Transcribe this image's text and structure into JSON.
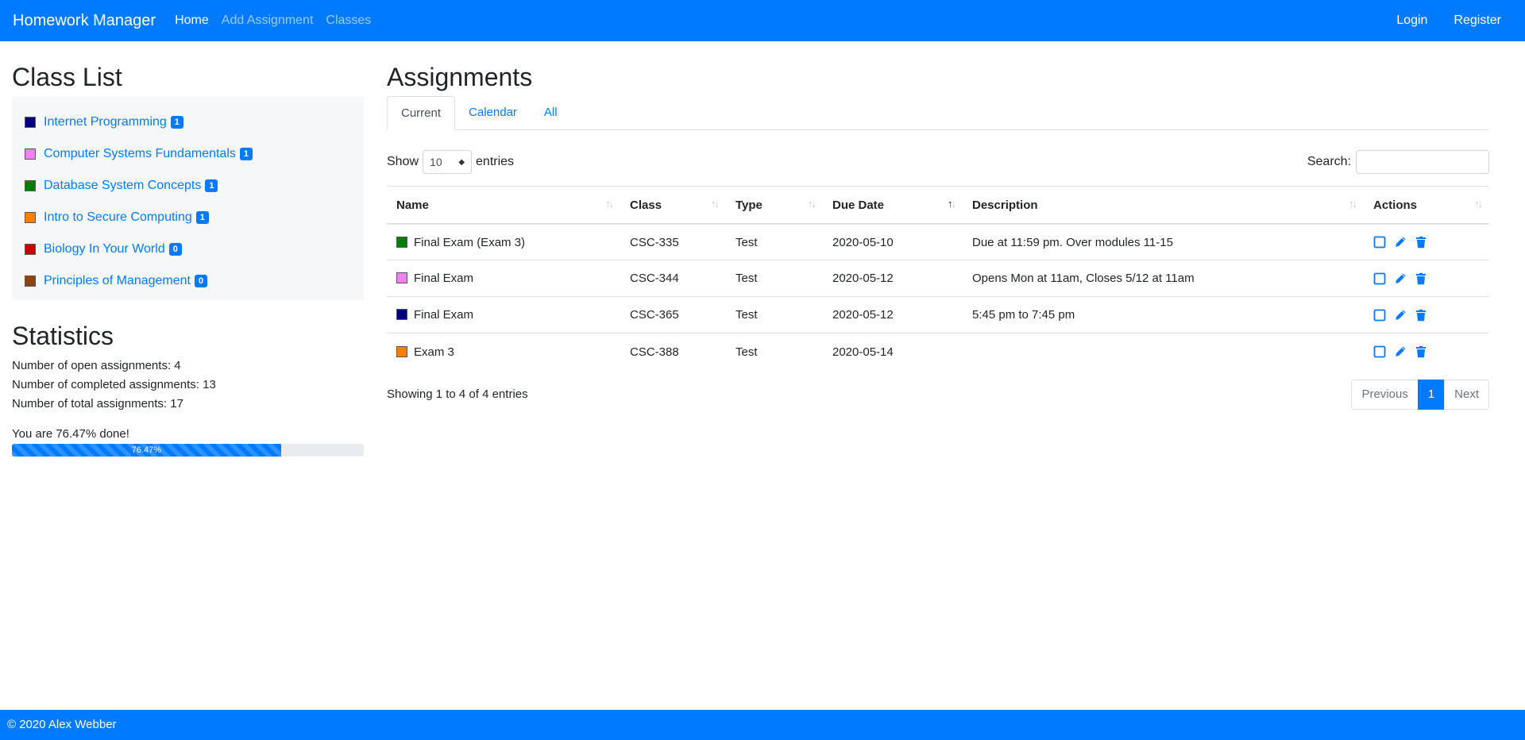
{
  "nav": {
    "brand": "Homework Manager",
    "links": [
      "Home",
      "Add Assignment",
      "Classes"
    ],
    "right_links": [
      "Login",
      "Register"
    ]
  },
  "class_list": {
    "title": "Class List",
    "items": [
      {
        "name": "Internet Programming",
        "count": "1",
        "color": "#000080"
      },
      {
        "name": "Computer Systems Fundamentals",
        "count": "1",
        "color": "#ee82ee"
      },
      {
        "name": "Database System Concepts",
        "count": "1",
        "color": "#008000"
      },
      {
        "name": "Intro to Secure Computing",
        "count": "1",
        "color": "#ff8000"
      },
      {
        "name": "Biology In Your World",
        "count": "0",
        "color": "#cc0000"
      },
      {
        "name": "Principles of Management",
        "count": "0",
        "color": "#8b4513"
      }
    ]
  },
  "statistics": {
    "title": "Statistics",
    "open": "Number of open assignments: 4",
    "completed": "Number of completed assignments: 13",
    "total": "Number of total assignments: 17",
    "done_text": "You are 76.47% done!",
    "progress_label": "76.47%",
    "progress_percent": 76.47
  },
  "assignments": {
    "title": "Assignments",
    "tabs": [
      "Current",
      "Calendar",
      "All"
    ],
    "show_label": "Show",
    "entries_label": "entries",
    "length_value": "10",
    "search_label": "Search:",
    "search_value": "",
    "columns": [
      "Name",
      "Class",
      "Type",
      "Due Date",
      "Description",
      "Actions"
    ],
    "rows": [
      {
        "name": "Final Exam (Exam 3)",
        "color": "#008000",
        "class": "CSC-335",
        "type": "Test",
        "due": "2020-05-10",
        "description": "Due at 11:59 pm. Over modules 11-15"
      },
      {
        "name": "Final Exam",
        "color": "#ee82ee",
        "class": "CSC-344",
        "type": "Test",
        "due": "2020-05-12",
        "description": "Opens Mon at 11am, Closes 5/12 at 11am"
      },
      {
        "name": "Final Exam",
        "color": "#000080",
        "class": "CSC-365",
        "type": "Test",
        "due": "2020-05-12",
        "description": "5:45 pm to 7:45 pm"
      },
      {
        "name": "Exam 3",
        "color": "#ff8000",
        "class": "CSC-388",
        "type": "Test",
        "due": "2020-05-14",
        "description": ""
      }
    ],
    "info": "Showing 1 to 4 of 4 entries",
    "pagination": {
      "previous": "Previous",
      "page": "1",
      "next": "Next"
    }
  },
  "footer": {
    "text": "© 2020 Alex Webber"
  },
  "colors": {
    "accent": "#007bff"
  },
  "icons": {
    "sort": "sort-arrows-icon",
    "complete": "checkbox-icon",
    "edit": "pencil-icon",
    "delete": "trash-icon"
  }
}
